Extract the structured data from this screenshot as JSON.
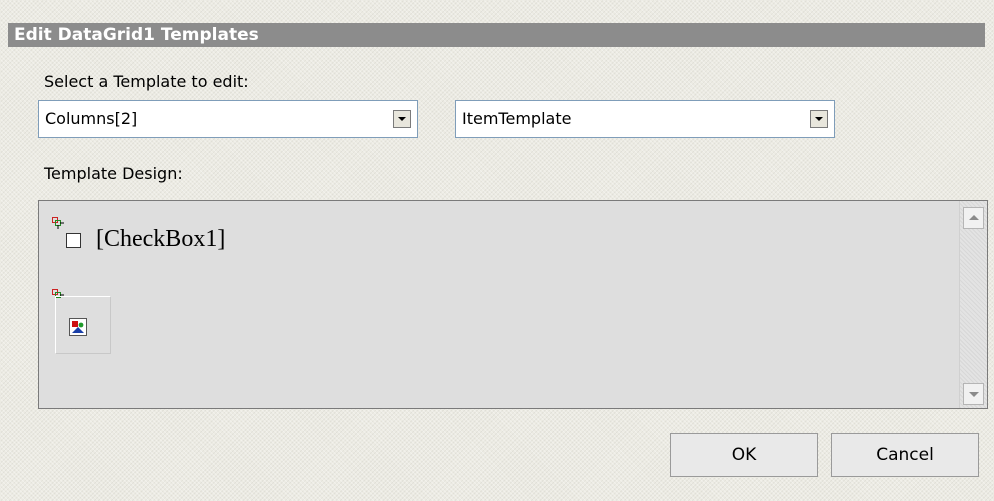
{
  "dialog": {
    "title": "Edit DataGrid1 Templates"
  },
  "template_select": {
    "label": "Select a Template to edit:",
    "column_value": "Columns[2]",
    "template_value": "ItemTemplate"
  },
  "design": {
    "label": "Template Design:",
    "checkbox_label": "[CheckBox1]"
  },
  "buttons": {
    "ok": "OK",
    "cancel": "Cancel"
  },
  "icons": {
    "control_glyph": "control-handle-icon",
    "image_placeholder": "image-placeholder-icon"
  }
}
